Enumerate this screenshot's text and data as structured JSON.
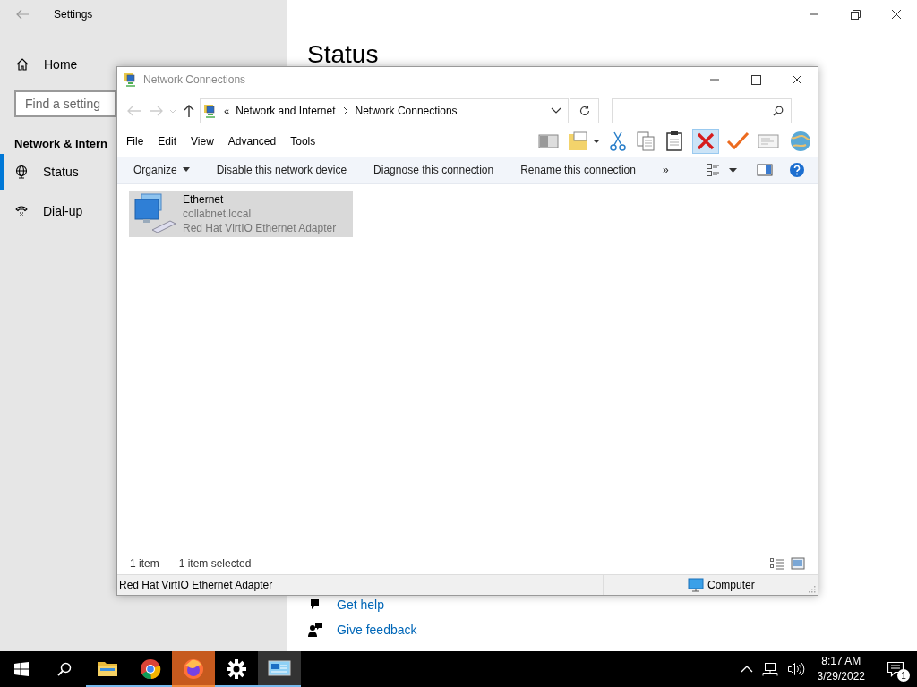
{
  "settings": {
    "title": "Settings",
    "home": "Home",
    "search": {
      "placeholder": "Find a setting"
    },
    "section": "Network & Intern",
    "nav": [
      {
        "kind": "globe",
        "label": "Status",
        "selected": true
      },
      {
        "kind": "phone",
        "label": "Dial-up",
        "selected": false
      }
    ],
    "heading": "Status",
    "links": [
      {
        "kind": "help",
        "label": "Get help"
      },
      {
        "kind": "feedback",
        "label": "Give feedback"
      }
    ]
  },
  "explorer": {
    "title": "Network Connections",
    "breadcrumb": {
      "overflow": "«",
      "parts": [
        "Network and Internet",
        "Network Connections"
      ]
    },
    "menu": [
      "File",
      "Edit",
      "View",
      "Advanced",
      "Tools"
    ],
    "commands": [
      {
        "label": "Organize",
        "dropdown": true
      },
      {
        "label": "Disable this network device",
        "dropdown": false
      },
      {
        "label": "Diagnose this connection",
        "dropdown": false
      },
      {
        "label": "Rename this connection",
        "dropdown": false
      }
    ],
    "more": "»",
    "items": [
      {
        "name": "Ethernet",
        "domain": "collabnet.local",
        "adapter": "Red Hat VirtIO Ethernet Adapter",
        "selected": true
      }
    ],
    "status": {
      "count": "1 item",
      "selection": "1 item selected"
    },
    "details": {
      "description": "Red Hat VirtIO Ethernet Adapter",
      "location": "Computer"
    }
  },
  "taskbar": {
    "apps": [
      {
        "kind": "folder",
        "selected": false,
        "flashing": false
      },
      {
        "kind": "chrome",
        "selected": false,
        "flashing": false
      },
      {
        "kind": "firefox",
        "selected": false,
        "flashing": true
      },
      {
        "kind": "gear",
        "selected": false,
        "flashing": false
      },
      {
        "kind": "network",
        "selected": true,
        "flashing": false
      }
    ],
    "time": "8:17 AM",
    "date": "3/29/2022",
    "notifications": "1"
  }
}
